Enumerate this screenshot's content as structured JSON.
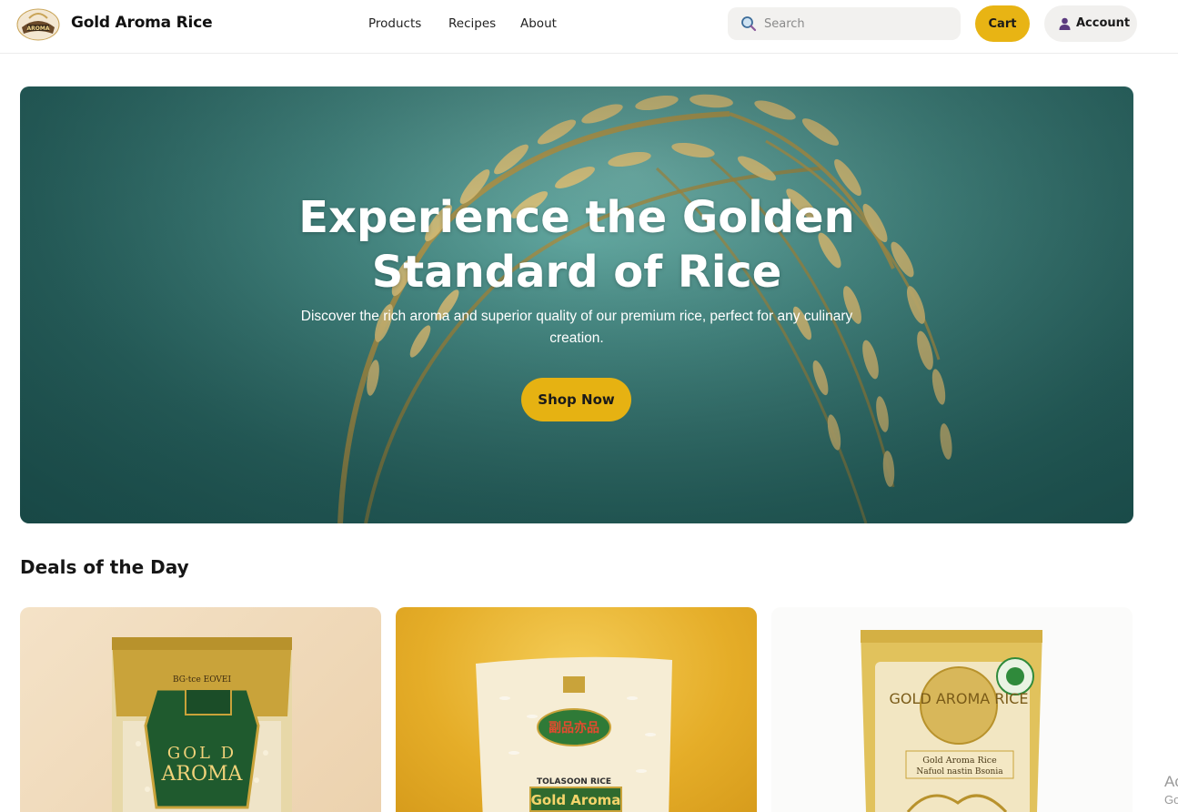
{
  "header": {
    "brand": "Gold Aroma Rice",
    "logo_text": "AROMA",
    "nav": [
      "Products",
      "Recipes",
      "About"
    ],
    "search_placeholder": "Search",
    "cart_label": "Cart",
    "account_label": "Account"
  },
  "hero": {
    "title": "Experience the Golden Standard of Rice",
    "subtitle": "Discover the rich aroma and superior quality of our premium rice, perfect for any culinary creation.",
    "cta": "Shop Now"
  },
  "deals": {
    "title": "Deals of the Day",
    "cards": [
      {
        "label_top": "GOL D",
        "label_main": "AROMA"
      },
      {
        "label_top": "TOLASOON RICE",
        "label_main": "Gold Aroma"
      },
      {
        "label_top": "GOLD AROMA RICE",
        "label_main": "Gold Aroma Rice"
      }
    ]
  },
  "edge": {
    "line1": "Ac",
    "line2": "Go"
  },
  "colors": {
    "accent": "#e8b414",
    "hero_bg": "#3f8682"
  }
}
